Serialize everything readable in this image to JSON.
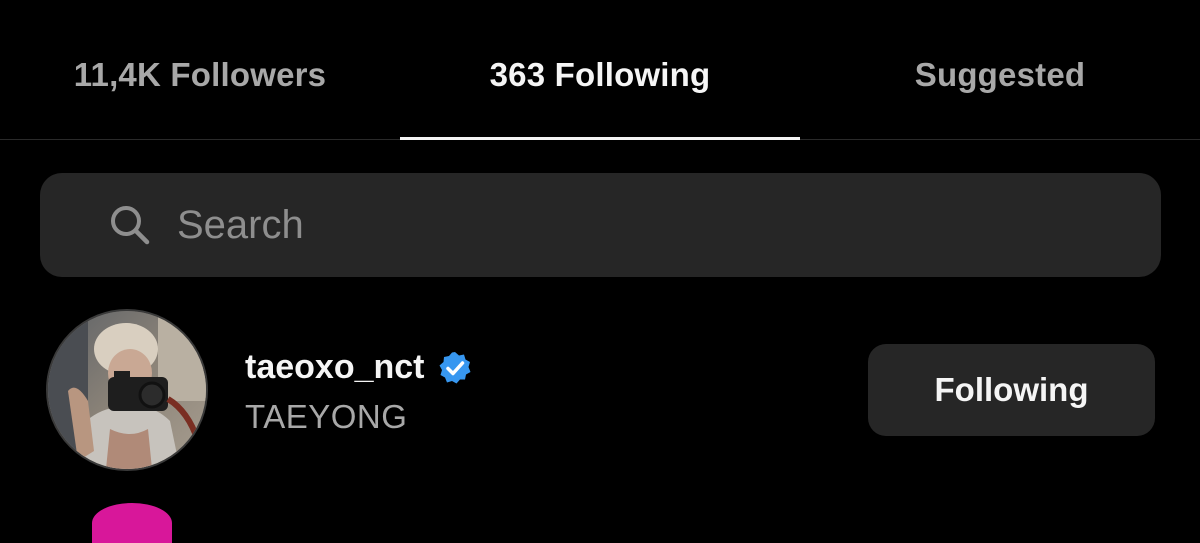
{
  "tabs": [
    {
      "label": "11,4K Followers",
      "active": false
    },
    {
      "label": "363 Following",
      "active": true
    },
    {
      "label": "Suggested",
      "active": false
    }
  ],
  "search": {
    "placeholder": "Search",
    "value": ""
  },
  "users": [
    {
      "username": "taeoxo_nct",
      "full_name": "TAEYONG",
      "verified": true,
      "button_label": "Following"
    }
  ],
  "icons": {
    "search": "search-icon",
    "verified": "verified-badge-icon"
  },
  "colors": {
    "background": "#000000",
    "active_text": "#f5f5f5",
    "inactive_text": "#a8a8a8",
    "surface": "#262626",
    "verified_blue": "#3797f0",
    "next_avatar_ring": "#d8179a"
  }
}
